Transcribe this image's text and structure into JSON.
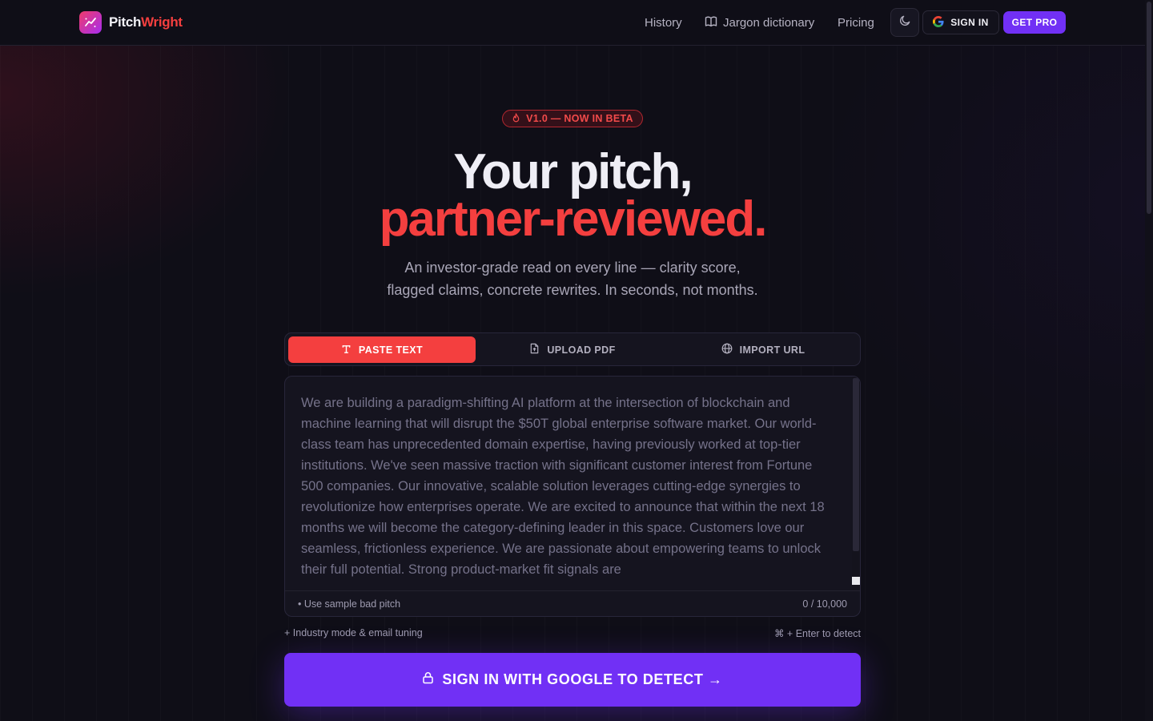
{
  "header": {
    "brand_part1": "Pitch",
    "brand_part2": "Wright",
    "nav": {
      "history": "History",
      "jargon": "Jargon dictionary",
      "pricing": "Pricing"
    },
    "sign_in": "SIGN IN",
    "get_pro": "GET PRO"
  },
  "hero": {
    "badge": "V1.0 — NOW IN BETA",
    "title_line1": "Your pitch,",
    "title_line2": "partner-reviewed.",
    "subtitle_line1": "An investor-grade read on every line — clarity score,",
    "subtitle_line2": "flagged claims, concrete rewrites. In seconds, not months."
  },
  "tabs": [
    {
      "label": "PASTE TEXT",
      "icon": "text-icon",
      "active": true
    },
    {
      "label": "UPLOAD PDF",
      "icon": "file-icon",
      "active": false
    },
    {
      "label": "IMPORT URL",
      "icon": "globe-icon",
      "active": false
    }
  ],
  "editor": {
    "placeholder": "We are building a paradigm-shifting AI platform at the intersection of blockchain and machine learning that will disrupt the $50T global enterprise software market. Our world-class team has unprecedented domain expertise, having previously worked at top-tier institutions. We've seen massive traction with significant customer interest from Fortune 500 companies. Our innovative, scalable solution leverages cutting-edge synergies to revolutionize how enterprises operate. We are excited to announce that within the next 18 months we will become the category-defining leader in this space. Customers love our seamless, frictionless experience. We are passionate about empowering teams to unlock their full potential. Strong product-market fit signals are",
    "sample_link": "• Use sample bad pitch",
    "char_count": "0 / 10,000"
  },
  "options": {
    "industry": "+ Industry mode & email tuning",
    "shortcut": "⌘ + Enter to detect"
  },
  "cta": {
    "label": "SIGN IN WITH GOOGLE TO DETECT →"
  },
  "colors": {
    "accent_red": "#f43f3f",
    "accent_purple": "#7130f5",
    "background": "#0f0e17"
  }
}
